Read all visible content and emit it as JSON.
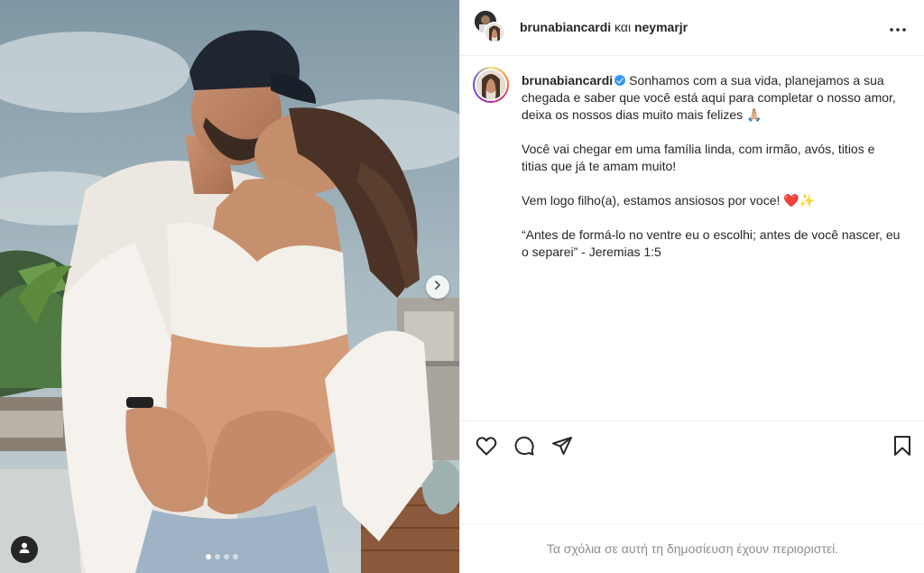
{
  "post": {
    "header": {
      "author": "brunabiancardi",
      "connector": "και",
      "coauthor": "neymarjr"
    },
    "caption": {
      "author": "brunabiancardi",
      "paragraphs": [
        "Sonhamos com a sua vida, planejamos a sua chegada e saber que você está aqui para completar o nosso amor, deixa os nossos dias muito mais felizes 🙏🏼",
        "Você vai chegar em uma família linda, com irmão, avós, titios e titias que já te amam muito!",
        "Vem logo filho(a), estamos ansiosos por voce! ❤️✨",
        "“Antes de formá-lo no ventre eu o escolhi; antes de você nascer, eu o separei” - Jeremias 1:5"
      ]
    },
    "comments_notice": "Τα σχόλια σε αυτή τη δημοσίευση έχουν περιοριστεί.",
    "carousel": {
      "total": 4,
      "current": 1
    }
  },
  "icons": {
    "like": "heart-icon",
    "comment": "comment-icon",
    "share": "share-icon",
    "save": "bookmark-icon",
    "more": "more-icon",
    "next": "chevron-right-icon",
    "tags": "user-tag-icon",
    "verified": "verified-badge-icon"
  },
  "colors": {
    "text": "#262626",
    "muted": "#8e8e8e",
    "border": "#efefef",
    "verified": "#3897f0"
  }
}
